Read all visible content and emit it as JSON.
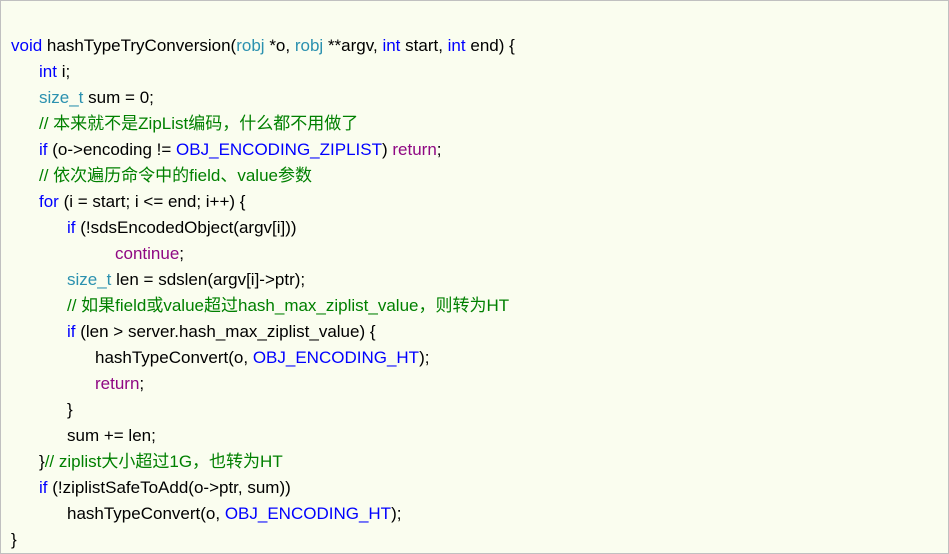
{
  "code": {
    "l1": {
      "kw_void": "void",
      "fn": "hashTypeTryConversion",
      "p1_type": "robj",
      "p1_name": "*o",
      "p2_type": "robj",
      "p2_name": "**argv",
      "p3_type": "int",
      "p3_name": "start",
      "p4_type": "int",
      "p4_name": "end",
      "open": ") {"
    },
    "l2": {
      "type": "int",
      "name": "i;"
    },
    "l3": {
      "type": "size_t",
      "name": "sum",
      "eq": "=",
      "val": "0",
      ";": ";"
    },
    "l4": {
      "cmt": "// 本来就不是ZipList编码，什么都不用做了"
    },
    "l5": {
      "kw_if": "if",
      "open": "(o->encoding != ",
      "enc": "OBJ_ENCODING_ZIPLIST",
      "close": ") ",
      "ret": "return",
      "sc": ";"
    },
    "l6": {
      "cmt": "// 依次遍历命令中的field、value参数"
    },
    "l7": {
      "kw_for": "for",
      "body": " (i = start; i <= end; i++) {"
    },
    "l8": {
      "kw_if": "if",
      "body": " (!sdsEncodedObject(argv[i]))"
    },
    "l9": {
      "kw": "continue",
      "sc": ";"
    },
    "l10": {
      "type": "size_t",
      "rest": " len = sdslen(argv[i]->ptr);"
    },
    "l11": {
      "cmt": "// 如果field或value超过hash_max_ziplist_value，则转为HT"
    },
    "l12": {
      "kw_if": "if",
      "body": " (len > server.hash_max_ziplist_value) {"
    },
    "l13": {
      "fn": "hashTypeConvert(o, ",
      "enc": "OBJ_ENCODING_HT",
      "close": ");"
    },
    "l14": {
      "ret": "return",
      "sc": ";"
    },
    "l15": {
      "brace": "}"
    },
    "l16": {
      "stmt": "sum += len;"
    },
    "l17": {
      "brace": "}",
      "cmt": "// ziplist大小超过1G，也转为HT"
    },
    "l18": {
      "kw_if": "if",
      "body": " (!ziplistSafeToAdd(o->ptr, sum))"
    },
    "l19": {
      "fn": "hashTypeConvert(o, ",
      "enc": "OBJ_ENCODING_HT",
      "close": ");"
    },
    "l20": {
      "brace": "}"
    }
  }
}
